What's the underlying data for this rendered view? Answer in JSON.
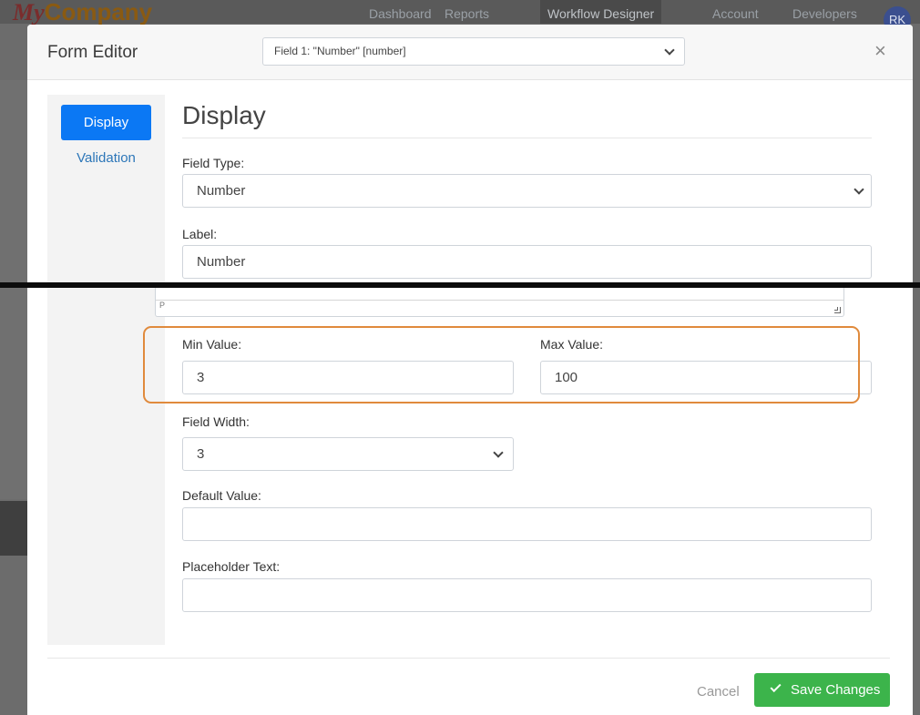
{
  "background": {
    "logo_my": "My",
    "logo_company": "Company",
    "nav": [
      {
        "label": "Dashboard"
      },
      {
        "label": "Reports"
      },
      {
        "label": "Workflow Designer"
      },
      {
        "label": "Account"
      },
      {
        "label": "Developers"
      }
    ],
    "avatar": "RK"
  },
  "modal": {
    "title": "Form Editor",
    "field_selector_value": "Field 1: \"Number\" [number]",
    "close_glyph": "×"
  },
  "sidenav": {
    "items": [
      {
        "label": "Display",
        "active": true
      },
      {
        "label": "Validation",
        "active": false
      }
    ]
  },
  "form": {
    "section_title": "Display",
    "field_type_label": "Field Type:",
    "field_type_value": "Number",
    "label_label": "Label:",
    "label_value": "Number",
    "textarea_toolbar_text": "P",
    "min_value_label": "Min Value:",
    "min_value": "3",
    "max_value_label": "Max Value:",
    "max_value": "100",
    "field_width_label": "Field Width:",
    "field_width_value": "3",
    "default_value_label": "Default Value:",
    "default_value": "",
    "placeholder_label": "Placeholder Text:",
    "placeholder_value": ""
  },
  "footer": {
    "cancel_label": "Cancel",
    "save_label": "Save Changes"
  },
  "colors": {
    "primary": "#0b78f4",
    "success": "#3cb44b",
    "highlight": "#e08a3c",
    "link": "#2c76b8"
  }
}
